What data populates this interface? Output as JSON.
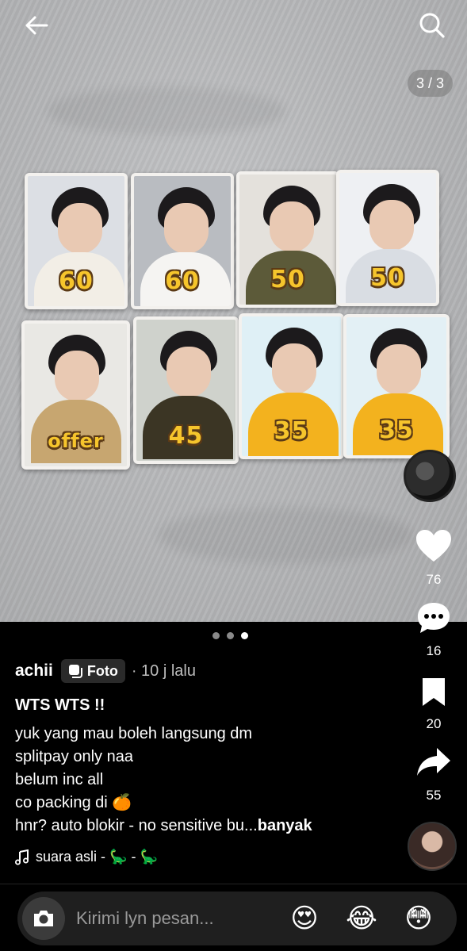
{
  "header": {
    "back_icon": "arrow-left-icon",
    "search_icon": "search-icon",
    "image_counter": "3 / 3"
  },
  "photocards": [
    {
      "price": "60",
      "outfit": "#f2eee6",
      "bg": "#dcdfe4"
    },
    {
      "price": "60",
      "outfit": "#f5f4f2",
      "bg": "#b9bcc1"
    },
    {
      "price": "50",
      "outfit": "#5c5a39",
      "bg": "#e4e1dc"
    },
    {
      "price": "50",
      "outfit": "#d9dde3",
      "bg": "#eef0f3"
    },
    {
      "price": "offer",
      "outfit": "#c7a670",
      "bg": "#e9e8e4"
    },
    {
      "price": "45",
      "outfit": "#3b3524",
      "bg": "#cfd2cc"
    },
    {
      "price": "35",
      "outfit": "#f3b21e",
      "bg": "#dff0f6"
    },
    {
      "price": "35",
      "outfit": "#f3b21e",
      "bg": "#e3f0f5"
    }
  ],
  "carousel_dots": 3,
  "actions": {
    "likes": "76",
    "comments": "16",
    "saves": "20",
    "shares": "55"
  },
  "post": {
    "username": "achii",
    "badge_label": "Foto",
    "time": "· 10 j lalu",
    "title": "WTS WTS !!",
    "lines": [
      "yuk yang mau boleh langsung dm",
      "splitpay only naa",
      "belum inc all",
      "co packing di 🍊"
    ],
    "last_line": "hnr? auto blokir - no sensitive bu...",
    "more_label": "banyak",
    "music": "suara asli - 🦕 - 🦕"
  },
  "message_bar": {
    "placeholder": "Kirimi lyn pesan...",
    "emojis": [
      "😍",
      "😂",
      "😳"
    ]
  },
  "colors": {
    "background": "#000000",
    "price_yellow": "#f6c52c"
  }
}
